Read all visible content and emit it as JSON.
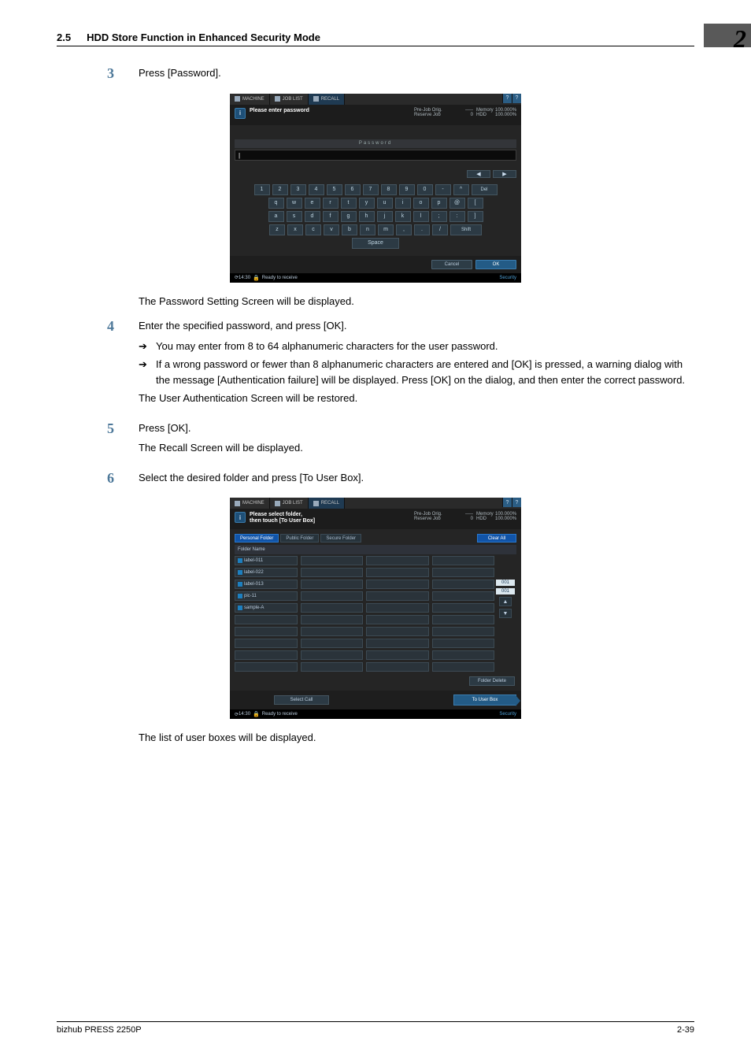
{
  "section": {
    "number": "2.5",
    "title": "HDD Store Function in Enhanced Security Mode"
  },
  "chapter_badge": "2",
  "steps": {
    "s3": {
      "num": "3",
      "text": "Press [Password].",
      "after": "The Password Setting Screen will be displayed."
    },
    "s4": {
      "num": "4",
      "text": "Enter the specified password, and press [OK].",
      "b1": "You may enter from 8 to 64 alphanumeric characters for the user password.",
      "b2": "If a wrong password or fewer than 8 alphanumeric characters are entered and [OK] is pressed, a warning dialog with the message [Authentication failure] will be displayed. Press [OK] on the dialog, and then enter the correct password.",
      "after": "The User Authentication Screen will be restored."
    },
    "s5": {
      "num": "5",
      "text": "Press [OK].",
      "after": "The Recall Screen will be displayed."
    },
    "s6": {
      "num": "6",
      "text": "Select the desired folder and press [To User Box].",
      "after": "The list of user boxes will be displayed."
    }
  },
  "arrow": "➔",
  "ss_common": {
    "tab_machine": "MACHINE",
    "tab_joblist": "JOB LIST",
    "tab_recall": "RECALL",
    "help_icon": "?",
    "gear_icon": "?",
    "meter_r1_a": "Pre-Job Orig.",
    "meter_r1_b": "-----",
    "meter_r1_c": "Memory",
    "meter_r1_d": "100.000%",
    "meter_r2_a": "Reserve Job",
    "meter_r2_b": "0",
    "meter_r2_c": "HDD",
    "meter_r2_d": "100.000%",
    "status_time": "14:30",
    "status_text": "Ready to receive",
    "status_security": "Security"
  },
  "ss1": {
    "info": "Please enter password",
    "password_label": "Password",
    "cursor": "|",
    "nav_left": "◀",
    "nav_right": "▶",
    "row1": [
      "1",
      "2",
      "3",
      "4",
      "5",
      "6",
      "7",
      "8",
      "9",
      "0",
      "-",
      "^",
      "Del"
    ],
    "row2": [
      "q",
      "w",
      "e",
      "r",
      "t",
      "y",
      "u",
      "i",
      "o",
      "p",
      "@",
      "["
    ],
    "row3": [
      "a",
      "s",
      "d",
      "f",
      "g",
      "h",
      "j",
      "k",
      "l",
      ";",
      ":",
      "]"
    ],
    "row4": [
      "z",
      "x",
      "c",
      "v",
      "b",
      "n",
      "m",
      ",",
      ".",
      "/",
      "Shift"
    ],
    "space": "Space",
    "cancel": "Cancel",
    "ok": "OK"
  },
  "ss2": {
    "info_l1": "Please select folder,",
    "info_l2": "then touch [To User Box]",
    "tab_personal": "Personal Folder",
    "tab_public": "Public Folder",
    "tab_secure": "Secure Folder",
    "clear_all": "Clear All",
    "header": "Folder Name",
    "folders": [
      "label-011",
      "label-022",
      "label-013",
      "pic-11",
      "sample-A"
    ],
    "counter1": "001",
    "counter2": "001",
    "up": "▲",
    "down": "▼",
    "folder_delete": "Folder Delete",
    "select_call": "Select Call",
    "to_user_box": "To User Box"
  },
  "footer": {
    "left": "bizhub PRESS 2250P",
    "right": "2-39"
  }
}
